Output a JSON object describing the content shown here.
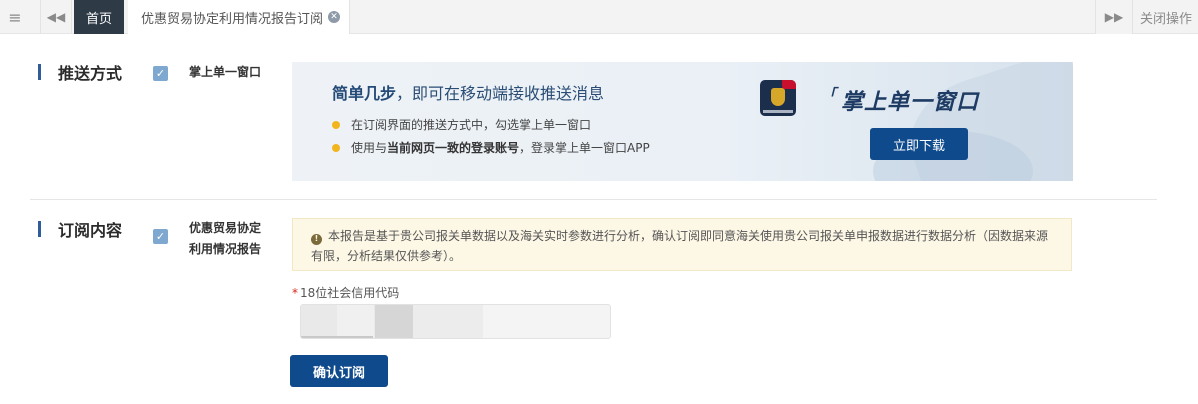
{
  "tabbar": {
    "menu_icon": "menu-icon",
    "prev_icon": "double-chevron-left-icon",
    "next_icon": "double-chevron-right-icon",
    "home_tab": "首页",
    "report_tab": "优惠贸易协定利用情况报告订阅",
    "close_ops": "关闭操作"
  },
  "push": {
    "title": "推送方式",
    "option_label": "掌上单一窗口",
    "checked": true
  },
  "banner": {
    "title_bold": "简单几步",
    "title_rest": "，即可在移动端接收推送消息",
    "line1": "在订阅界面的推送方式中，勾选掌上单一窗口",
    "line2_pre": "使用与",
    "line2_bold": "当前网页一致的登录账号",
    "line2_post": "，登录掌上单一窗口APP",
    "brand": "掌上单一窗口",
    "download_label": "立即下载",
    "accent_color": "#0f4a8c",
    "dot_color": "#f2b51d"
  },
  "subscription": {
    "title": "订阅内容",
    "option_label_line1": "优惠贸易协定",
    "option_label_line2": "利用情况报告",
    "checked": true,
    "notice": "本报告是基于贵公司报关单数据以及海关实时参数进行分析，确认订阅即同意海关使用贵公司报关单申报数据进行数据分析（因数据来源有限，分析结果仅供参考）。",
    "field_required_mark": "*",
    "field_label": "18位社会信用代码",
    "confirm_label": "确认订阅"
  }
}
